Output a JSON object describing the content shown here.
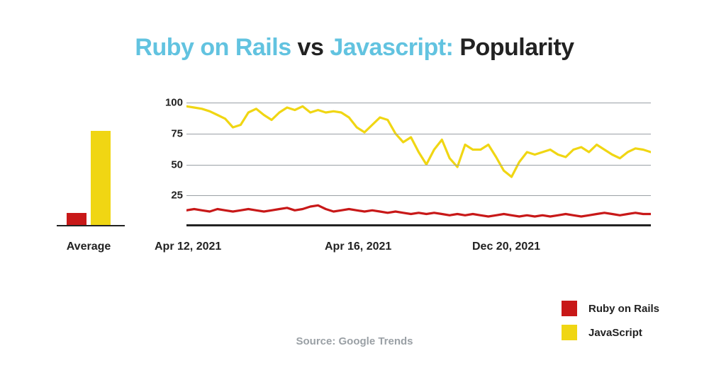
{
  "title": {
    "part1": "Ruby on Rails",
    "vs": " vs ",
    "part2": "Javascript:",
    "rest": " Popularity"
  },
  "mini": {
    "label": "Average",
    "ruby_value": 10,
    "js_value": 76
  },
  "x_ticks": [
    "Apr 12, 2021",
    "Apr 16, 2021",
    "Dec 20, 2021"
  ],
  "y_ticks": [
    25,
    50,
    75,
    100
  ],
  "legend": {
    "ruby": "Ruby on Rails",
    "js": "JavaScript"
  },
  "source": "Source: Google Trends",
  "colors": {
    "ruby": "#c81818",
    "js": "#f0d613",
    "highlight": "#62c3e0"
  },
  "chart_data": {
    "type": "line",
    "title": "Ruby on Rails vs Javascript: Popularity",
    "ylabel": "",
    "xlabel": "",
    "ylim": [
      0,
      100
    ],
    "x_tick_labels": [
      "Apr 12, 2021",
      "Apr 16, 2021",
      "Dec 20, 2021"
    ],
    "series": [
      {
        "name": "JavaScript",
        "values": [
          97,
          96,
          95,
          93,
          90,
          87,
          80,
          82,
          92,
          95,
          90,
          86,
          92,
          96,
          94,
          97,
          92,
          94,
          92,
          93,
          92,
          88,
          80,
          76,
          82,
          88,
          86,
          75,
          68,
          72,
          60,
          50,
          62,
          70,
          55,
          48,
          66,
          62,
          62,
          66,
          56,
          45,
          40,
          52,
          60,
          58,
          60,
          62,
          58,
          56,
          62,
          64,
          60,
          66,
          62,
          58,
          55,
          60,
          63,
          62,
          60
        ],
        "color": "#f0d613"
      },
      {
        "name": "Ruby on Rails",
        "values": [
          13,
          14,
          13,
          12,
          14,
          13,
          12,
          13,
          14,
          13,
          12,
          13,
          14,
          15,
          13,
          14,
          16,
          17,
          14,
          12,
          13,
          14,
          13,
          12,
          13,
          12,
          11,
          12,
          11,
          10,
          11,
          10,
          11,
          10,
          9,
          10,
          9,
          10,
          9,
          8,
          9,
          10,
          9,
          8,
          9,
          8,
          9,
          8,
          9,
          10,
          9,
          8,
          9,
          10,
          11,
          10,
          9,
          10,
          11,
          10,
          10
        ],
        "color": "#c81818"
      }
    ],
    "averages_bar": {
      "type": "bar",
      "categories": [
        "Ruby on Rails",
        "JavaScript"
      ],
      "values": [
        10,
        76
      ],
      "ylim": [
        0,
        100
      ]
    }
  }
}
